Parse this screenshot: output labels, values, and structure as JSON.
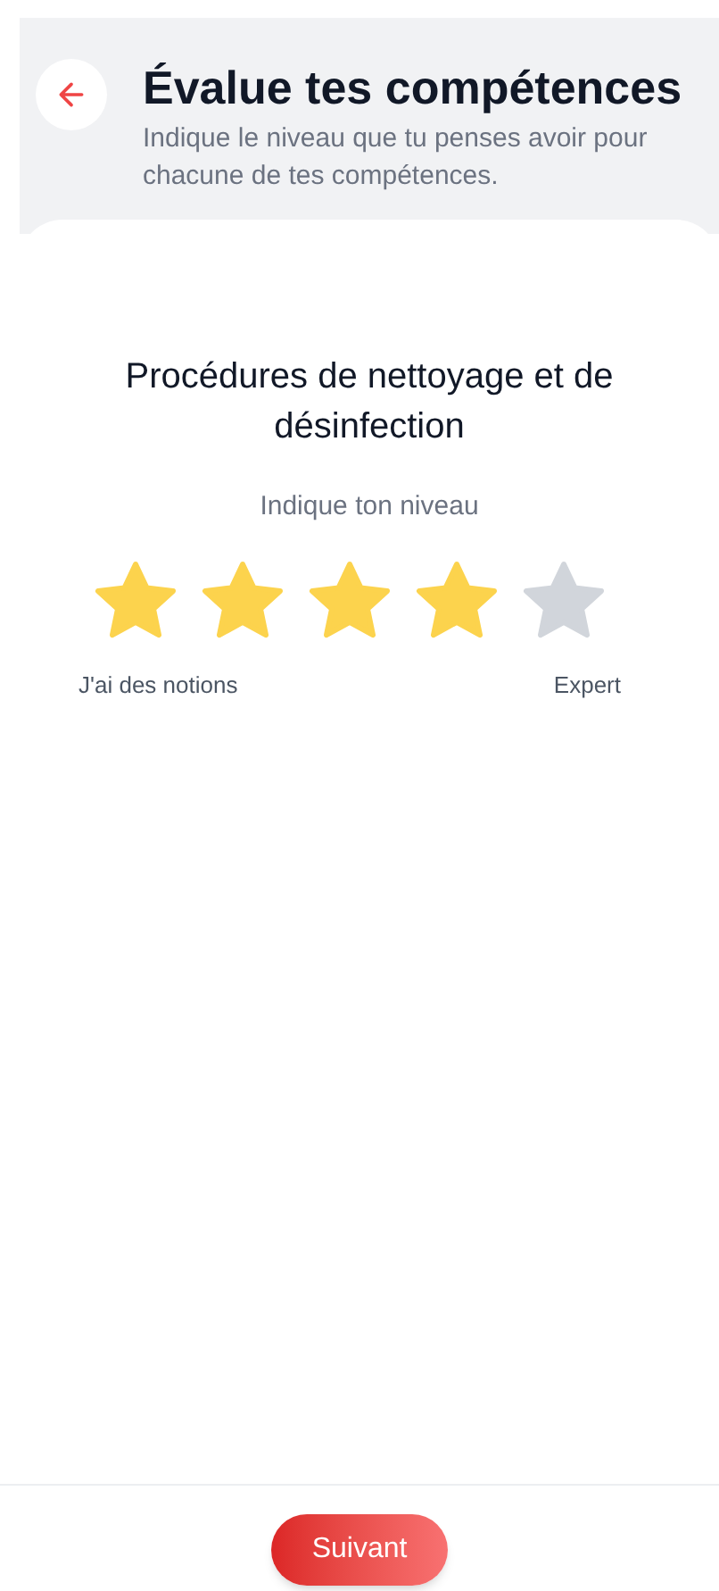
{
  "header": {
    "title": "Évalue tes compétences",
    "subtitle": "Indique le niveau que tu penses avoir pour chacune de tes compétences."
  },
  "skill": {
    "name": "Procédures de nettoyage et de désinfection",
    "prompt": "Indique ton niveau",
    "stars": 4,
    "low_label": "J'ai des notions",
    "high_label": "Expert"
  },
  "footer": {
    "button": "Suivant"
  }
}
